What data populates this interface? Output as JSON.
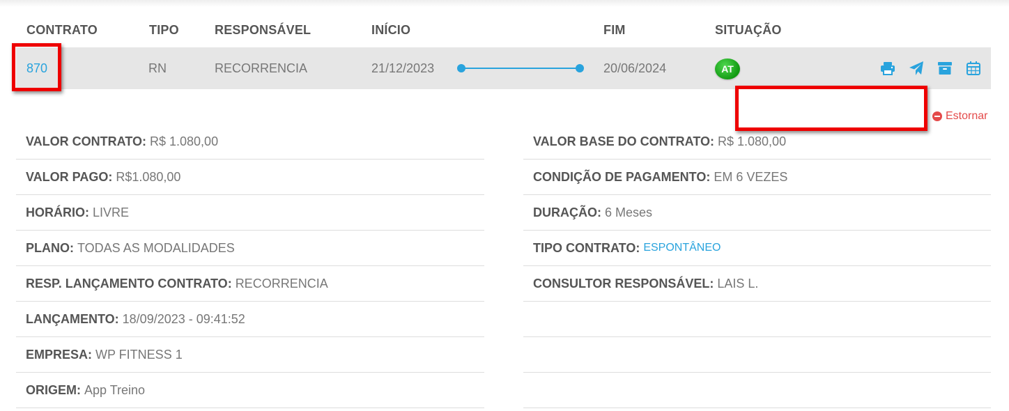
{
  "table": {
    "headers": {
      "contrato": "CONTRATO",
      "tipo": "TIPO",
      "responsavel": "RESPONSÁVEL",
      "inicio": "INÍCIO",
      "fim": "FIM",
      "situacao": "SITUAÇÃO"
    },
    "row": {
      "contrato": "870",
      "tipo": "RN",
      "responsavel": "RECORRENCIA",
      "inicio": "21/12/2023",
      "fim": "20/06/2024",
      "situacao": "AT"
    }
  },
  "actions": {
    "icons": [
      "print-icon",
      "send-icon",
      "archive-icon",
      "calendar-icon"
    ],
    "estornar": "Estornar"
  },
  "colors": {
    "accent": "#29a3dd",
    "status_active": "#1aa01a",
    "danger": "#e44a4a",
    "highlight_box": "#ee0000"
  },
  "details_left": [
    {
      "label": "VALOR CONTRATO:",
      "value": "R$ 1.080,00"
    },
    {
      "label": "VALOR PAGO:",
      "value": "R$1.080,00"
    },
    {
      "label": "HORÁRIO:",
      "value": "LIVRE"
    },
    {
      "label": "PLANO:",
      "value": "TODAS AS MODALIDADES"
    },
    {
      "label": "RESP. LANÇAMENTO CONTRATO:",
      "value": "RECORRENCIA"
    },
    {
      "label": "LANÇAMENTO:",
      "value": "18/09/2023 - 09:41:52"
    },
    {
      "label": "EMPRESA:",
      "value": "WP FITNESS 1"
    },
    {
      "label": "ORIGEM:",
      "value": "App Treino"
    }
  ],
  "details_right": [
    {
      "label": "VALOR BASE DO CONTRATO:",
      "value": "R$ 1.080,00"
    },
    {
      "label": "CONDIÇÃO DE PAGAMENTO:",
      "value": "EM 6 VEZES"
    },
    {
      "label": "DURAÇÃO:",
      "value": "6 Meses"
    },
    {
      "label": "TIPO CONTRATO:",
      "value": "ESPONTÂNEO"
    },
    {
      "label": "CONSULTOR RESPONSÁVEL:",
      "value": "LAIS L."
    }
  ]
}
